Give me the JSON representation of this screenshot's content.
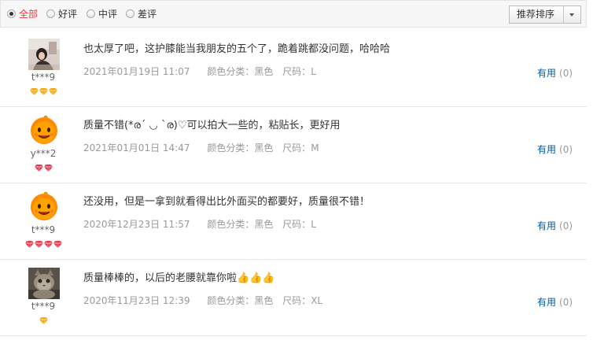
{
  "filters": [
    {
      "label": "全部",
      "checked": true
    },
    {
      "label": "好评",
      "checked": false
    },
    {
      "label": "中评",
      "checked": false
    },
    {
      "label": "差评",
      "checked": false
    }
  ],
  "sort": {
    "label": "推荐排序"
  },
  "reviews": [
    {
      "username": "t***9",
      "avatar_icon": "photo-avatar-icon",
      "gem_color": "#f5a600",
      "gem_count": 3,
      "content": "也太厚了吧，这护膝能当我朋友的五个了，跪着跳都没问题，哈哈哈",
      "date": "2021年01月19日 11:07",
      "color_label": "颜色分类：",
      "color_value": "黑色",
      "size_label": "尺码：",
      "size_value": "L",
      "useful_label": "有用",
      "useful_count": "(0)"
    },
    {
      "username": "y***2",
      "avatar_icon": "orange-mascot-avatar-icon",
      "gem_color": "#e8334a",
      "gem_count": 2,
      "content": "质量不错(*ര´ ◡ `ര)♡可以拍大一些的，粘贴长，更好用",
      "date": "2021年01月01日 14:47",
      "color_label": "颜色分类：",
      "color_value": "黑色",
      "size_label": "尺码：",
      "size_value": "M",
      "useful_label": "有用",
      "useful_count": "(0)"
    },
    {
      "username": "t***9",
      "avatar_icon": "orange-mascot-avatar-icon",
      "gem_color": "#e8334a",
      "gem_count": 4,
      "content": "还没用，但是一拿到就看得出比外面买的都要好，质量很不错！",
      "date": "2020年12月23日 11:57",
      "color_label": "颜色分类：",
      "color_value": "黑色",
      "size_label": "尺码：",
      "size_value": "L",
      "useful_label": "有用",
      "useful_count": "(0)"
    },
    {
      "username": "t***9",
      "avatar_icon": "cat-photo-avatar-icon",
      "gem_color": "#f5a600",
      "gem_count": 1,
      "content": "质量棒棒的，以后的老腰就靠你啦👍👍👍",
      "date": "2020年11月23日 12:39",
      "color_label": "颜色分类：",
      "color_value": "黑色",
      "size_label": "尺码：",
      "size_value": "XL",
      "useful_label": "有用",
      "useful_count": "(0)"
    }
  ]
}
